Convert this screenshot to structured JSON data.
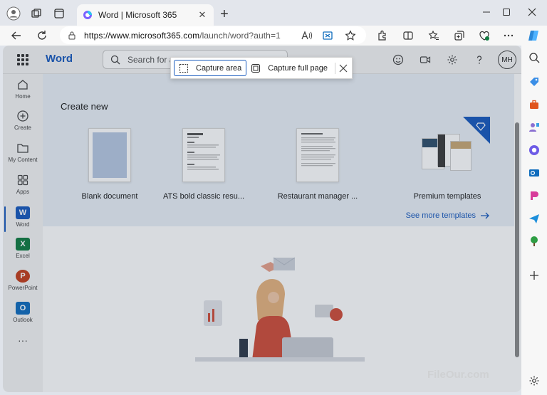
{
  "browser": {
    "tab_title": "Word | Microsoft 365",
    "url_host": "https://www.microsoft365.com",
    "url_path": "/launch/word?auth=1",
    "new_tab_symbol": "+",
    "tab_close_symbol": "✕"
  },
  "capture_bar": {
    "capture_area_label": "Capture area",
    "capture_full_page_label": "Capture full page"
  },
  "header": {
    "app_name": "Word",
    "search_placeholder": "Search for ap",
    "avatar_initials": "MH"
  },
  "rail": {
    "items": [
      {
        "label": "Home"
      },
      {
        "label": "Create"
      },
      {
        "label": "My Content"
      },
      {
        "label": "Apps"
      },
      {
        "label": "Word",
        "tile": "W"
      },
      {
        "label": "Excel",
        "tile": "X"
      },
      {
        "label": "PowerPoint",
        "tile": "P"
      },
      {
        "label": "Outlook",
        "tile": "O"
      }
    ],
    "more_symbol": "···"
  },
  "create": {
    "title": "Create new",
    "templates": [
      {
        "label": "Blank document"
      },
      {
        "label": "ATS bold classic resu..."
      },
      {
        "label": "Restaurant manager ..."
      },
      {
        "label": "Premium templates"
      }
    ],
    "see_more_label": "See more templates"
  },
  "watermark": "FileOur.com",
  "colors": {
    "word_blue": "#185abd",
    "excel_green": "#107c41",
    "powerpoint_orange": "#c43e1c",
    "outlook_blue": "#0f6cbd"
  }
}
